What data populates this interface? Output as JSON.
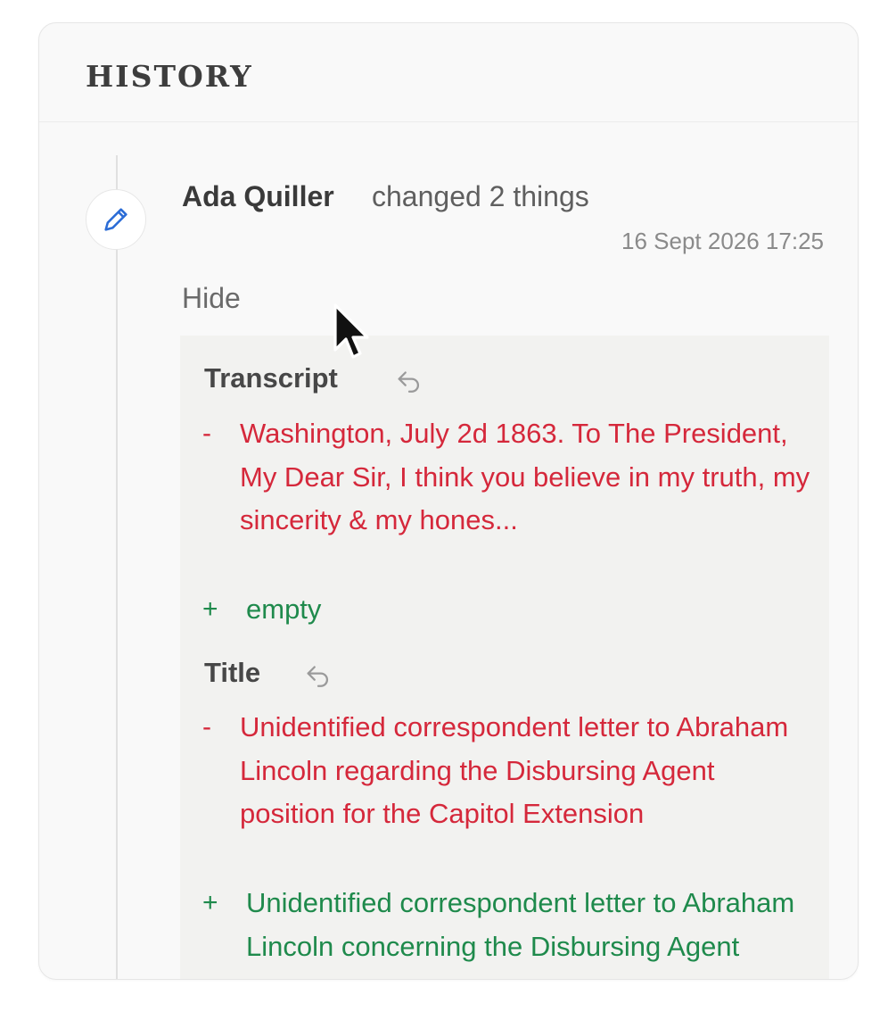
{
  "panel": {
    "title": "HISTORY"
  },
  "entry": {
    "author": "Ada Quiller",
    "action": "changed 2 things",
    "timestamp": "16 Sept 2026 17:25",
    "toggle_label": "Hide",
    "icon": "pencil-icon"
  },
  "changes": [
    {
      "field": "Transcript",
      "removed_sign": "-",
      "removed": "Washington, July 2d 1863. To The President, My Dear Sir, I think you believe in my truth, my sincerity & my hones...",
      "added_sign": "+",
      "added": "empty"
    },
    {
      "field": "Title",
      "removed_sign": "-",
      "removed": "Unidentified correspondent letter to Abraham Lincoln regarding the Disbursing Agent position for the Capitol Extension",
      "added_sign": "+",
      "added": "Unidentified correspondent letter to Abraham Lincoln concerning the Disbursing Agent position for the Capitol Extension"
    }
  ],
  "colors": {
    "removed": "#d5283b",
    "added": "#1f8a4c",
    "pencil": "#2b6cd6"
  }
}
